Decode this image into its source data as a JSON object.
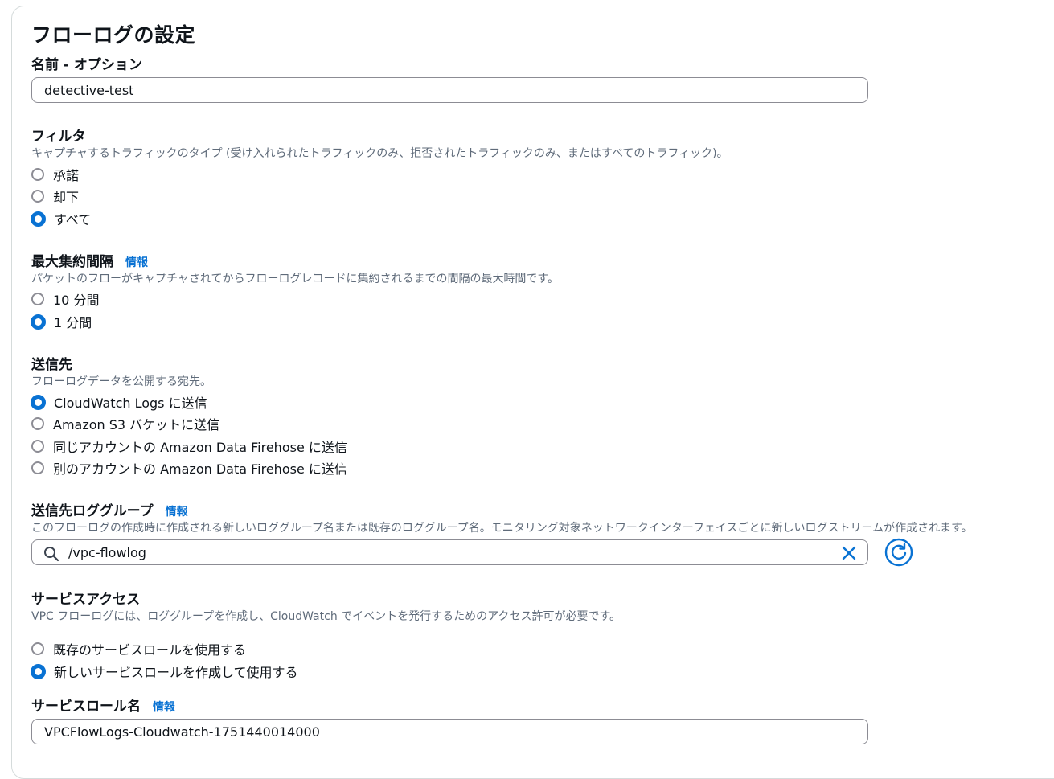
{
  "section_title": "フローログの設定",
  "name_field": {
    "label": "名前 - オプション",
    "value": "detective-test"
  },
  "filter": {
    "label": "フィルタ",
    "description": "キャプチャするトラフィックのタイプ (受け入れられたトラフィックのみ、拒否されたトラフィックのみ、またはすべてのトラフィック)。",
    "options": [
      "承諾",
      "却下",
      "すべて"
    ],
    "selected": "すべて"
  },
  "aggregation": {
    "label": "最大集約間隔",
    "info": "情報",
    "description": "パケットのフローがキャプチャされてからフローログレコードに集約されるまでの間隔の最大時間です。",
    "options": [
      "10 分間",
      "1 分間"
    ],
    "selected": "1 分間"
  },
  "destination": {
    "label": "送信先",
    "description": "フローログデータを公開する宛先。",
    "options": [
      "CloudWatch Logs に送信",
      "Amazon S3 バケットに送信",
      "同じアカウントの Amazon Data Firehose に送信",
      "別のアカウントの Amazon Data Firehose に送信"
    ],
    "selected": "CloudWatch Logs に送信"
  },
  "log_group": {
    "label": "送信先ロググループ",
    "info": "情報",
    "description": "このフローログの作成時に作成される新しいロググループ名または既存のロググループ名。モニタリング対象ネットワークインターフェイスごとに新しいログストリームが作成されます。",
    "value": "/vpc-flowlog",
    "icons": {
      "search": "search-icon",
      "clear": "close-icon",
      "refresh": "refresh-icon"
    }
  },
  "service_access": {
    "label": "サービスアクセス",
    "description": "VPC フローログには、ロググループを作成し、CloudWatch でイベントを発行するためのアクセス許可が必要です。",
    "options": [
      "既存のサービスロールを使用する",
      "新しいサービスロールを作成して使用する"
    ],
    "selected": "新しいサービスロールを作成して使用する"
  },
  "role_name": {
    "label": "サービスロール名",
    "info": "情報",
    "value": "VPCFlowLogs-Cloudwatch-1751440014000"
  },
  "colors": {
    "accent": "#0972d3",
    "text": "#0f141a",
    "secondary_text": "#5f6b7a",
    "border": "#8c8c94"
  }
}
